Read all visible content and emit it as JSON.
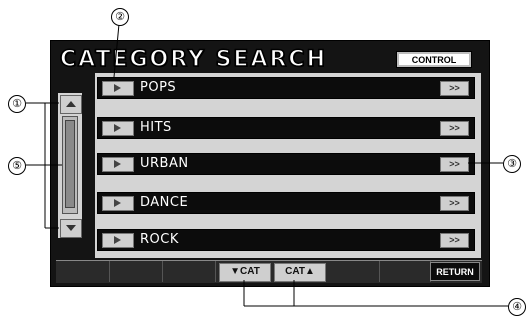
{
  "header": {
    "title": "CATEGORY SEARCH",
    "control_label": "CONTROL"
  },
  "categories": [
    {
      "label": "POPS",
      "more_label": ">>"
    },
    {
      "label": "HITS",
      "more_label": ">>"
    },
    {
      "label": "URBAN",
      "more_label": ">>"
    },
    {
      "label": "DANCE",
      "more_label": ">>"
    },
    {
      "label": "ROCK",
      "more_label": ">>"
    }
  ],
  "footer": {
    "cat_down_label": "▼CAT",
    "cat_up_label": "CAT▲",
    "return_label": "RETURN"
  },
  "callouts": [
    "①",
    "②",
    "③",
    "④",
    "⑤"
  ],
  "icons": {
    "play": "play-icon",
    "scroll_up": "arrow-up-icon",
    "scroll_down": "arrow-down-icon"
  }
}
